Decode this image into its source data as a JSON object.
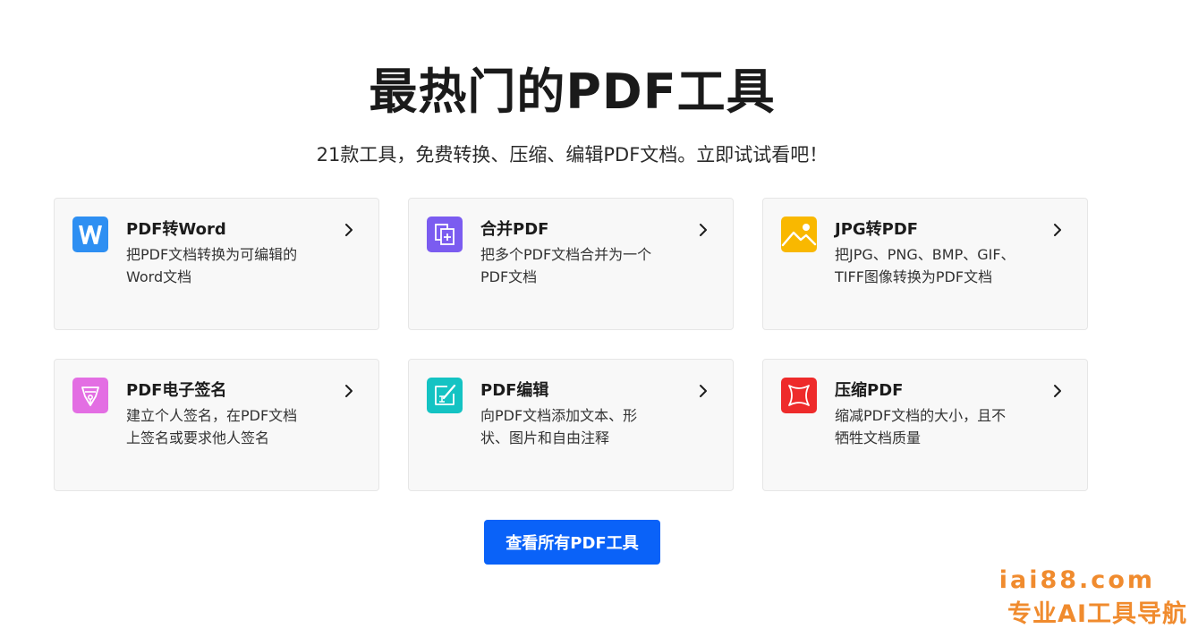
{
  "header": {
    "title": "最热门的PDF工具",
    "subtitle": "21款工具，免费转换、压缩、编辑PDF文档。立即试试看吧！"
  },
  "tools": [
    {
      "title": "PDF转Word",
      "desc_lines": [
        "把PDF文档转换为可编辑的",
        "Word文档"
      ],
      "icon": "word-icon",
      "color": "#2e8ff2"
    },
    {
      "title": "合并PDF",
      "desc_lines": [
        "把多个PDF文档合并为一个",
        "PDF文档"
      ],
      "icon": "merge-pdf-icon",
      "color": "#7b5cf0"
    },
    {
      "title": "JPG转PDF",
      "desc_lines": [
        "把JPG、PNG、BMP、GIF、",
        "TIFF图像转换为PDF文档"
      ],
      "icon": "image-icon",
      "color": "#f9b800"
    },
    {
      "title": "PDF电子签名",
      "desc_lines": [
        "建立个人签名，在PDF文档",
        "上签名或要求他人签名"
      ],
      "icon": "signature-pen-icon",
      "color": "#e36ee3"
    },
    {
      "title": "PDF编辑",
      "desc_lines": [
        "向PDF文档添加文本、形",
        "状、图片和自由注释"
      ],
      "icon": "edit-pdf-icon",
      "color": "#14c3c3"
    },
    {
      "title": "压缩PDF",
      "desc_lines": [
        "缩减PDF文档的大小，且不",
        "牺牲文档质量"
      ],
      "icon": "compress-icon",
      "color": "#ee2b2b"
    }
  ],
  "cta": {
    "label": "查看所有PDF工具",
    "color": "#0a62f8"
  },
  "watermark": {
    "domain": "iai88.com",
    "tagline": "专业AI工具导航",
    "color": "#f08b2e"
  }
}
